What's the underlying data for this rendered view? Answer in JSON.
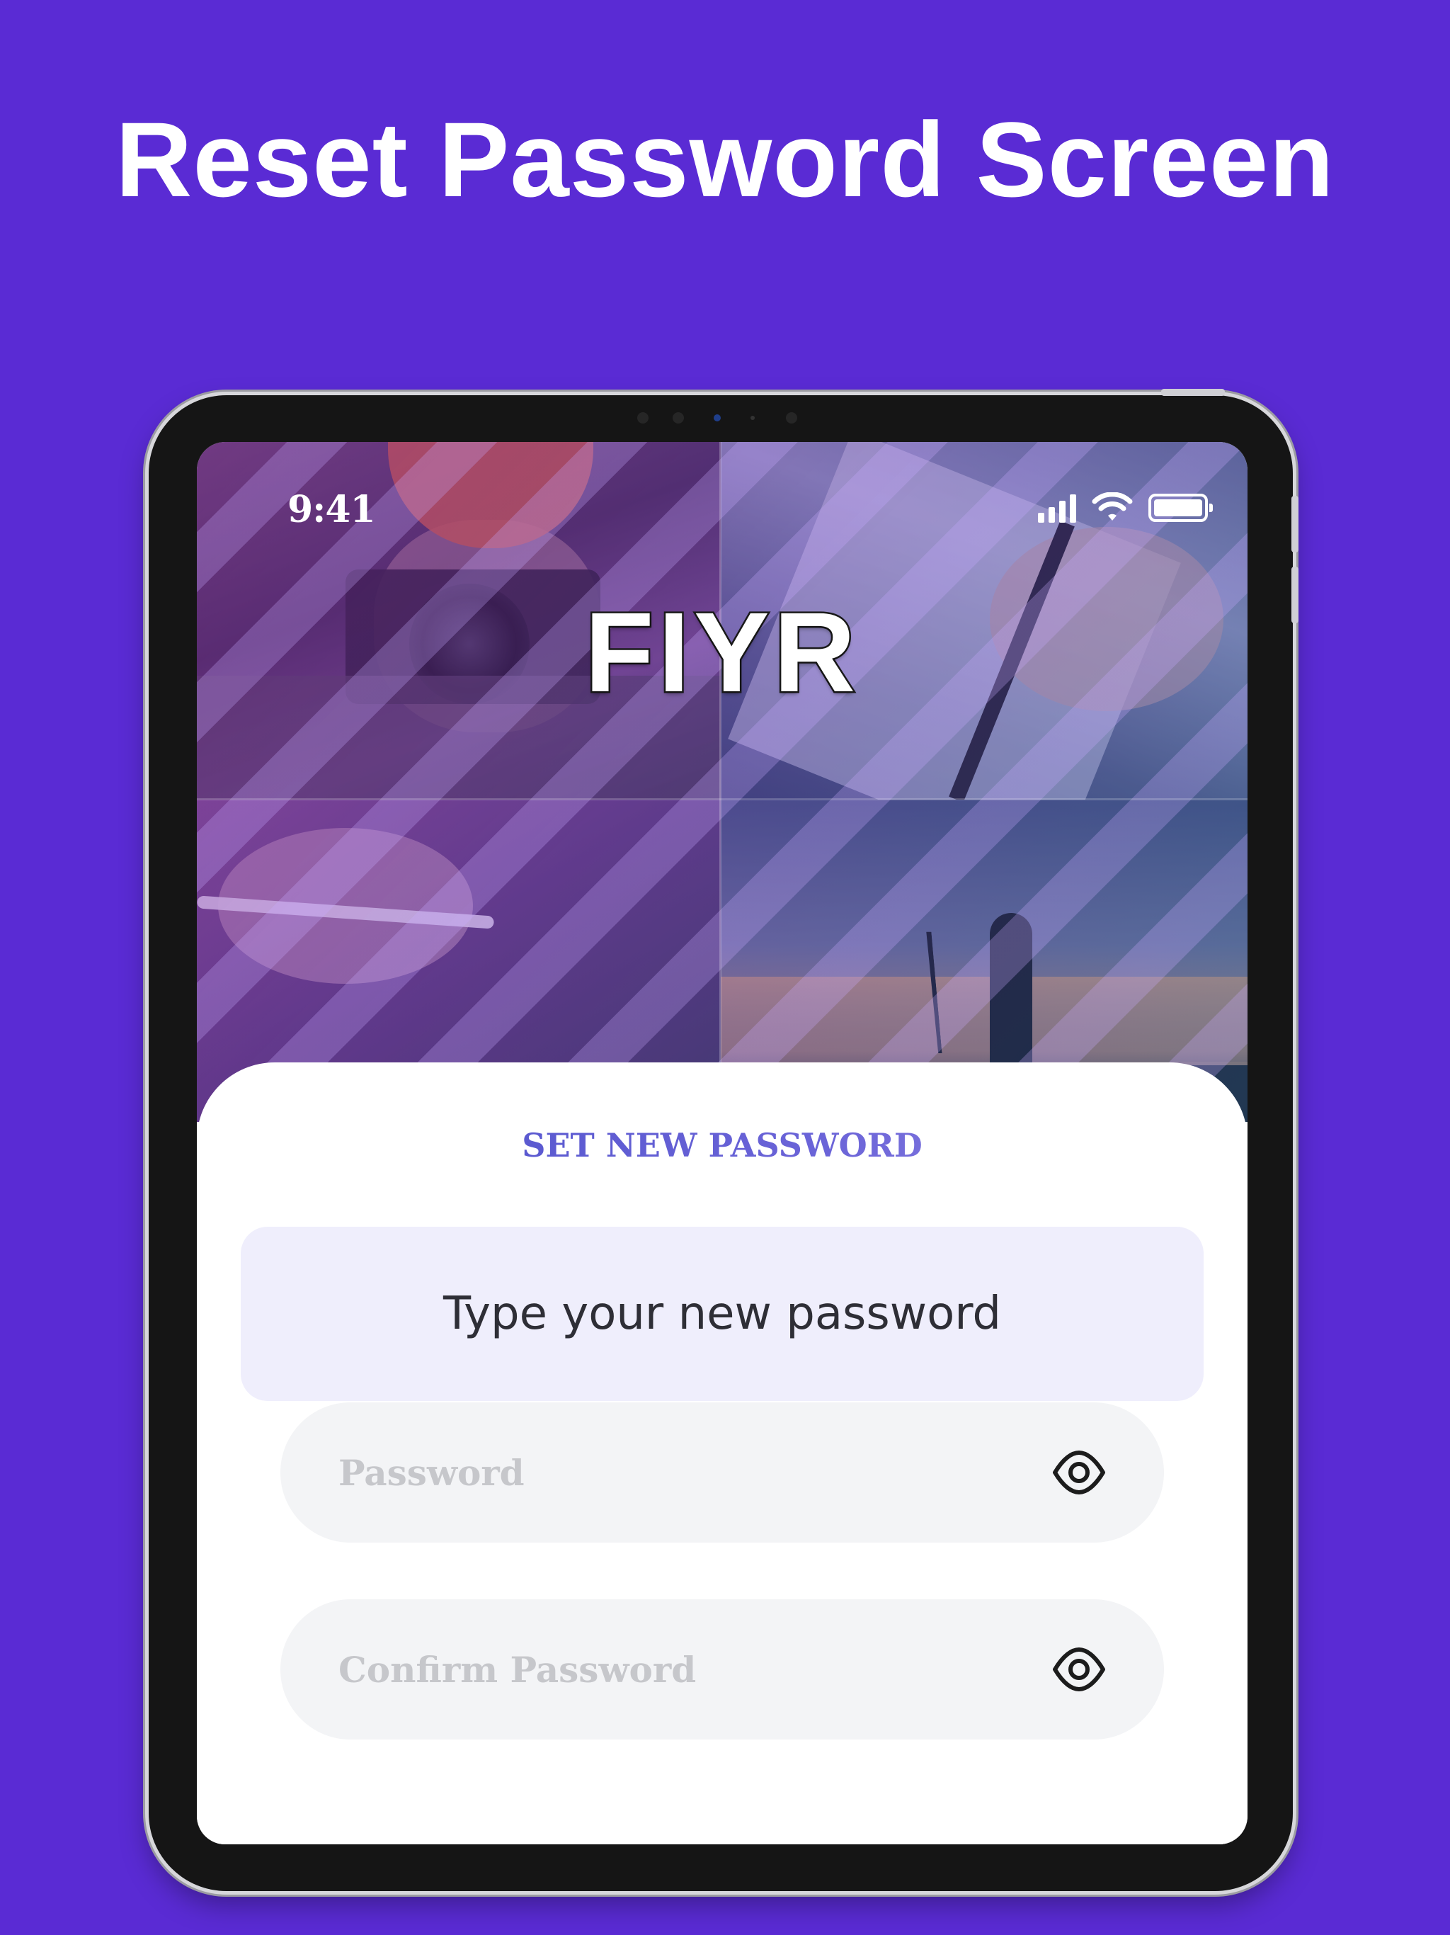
{
  "headline": "Reset Password Screen",
  "status_bar": {
    "time": "9:41",
    "icons": [
      "cellular-signal-icon",
      "wifi-icon",
      "battery-icon"
    ]
  },
  "hero": {
    "logo": "FIYR"
  },
  "sheet": {
    "title": "SET NEW PASSWORD",
    "info_text": "Type your new password",
    "password_placeholder": "Password",
    "confirm_placeholder": "Confirm Password",
    "visibility_icon": "eye-icon"
  },
  "colors": {
    "background": "#5a2bd4",
    "title_gradient_start": "#4a4fc8",
    "title_gradient_end": "#9a8fe6",
    "info_box": "#efeefc",
    "field": "#f3f4f6"
  }
}
